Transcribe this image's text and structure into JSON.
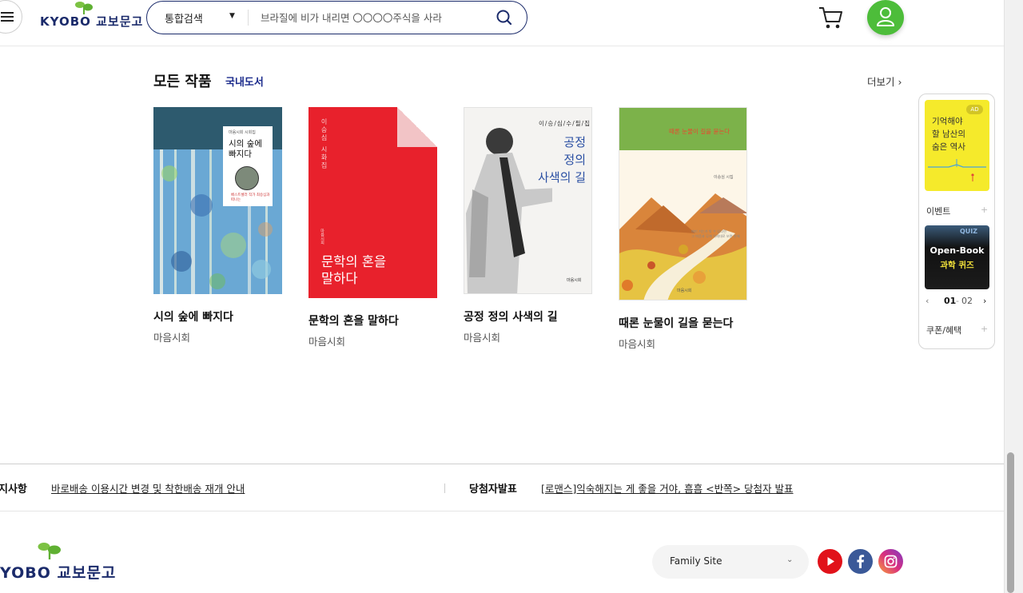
{
  "header": {
    "logo_text": "KYOBO 교보문고",
    "search": {
      "category": "통합검색",
      "placeholder": "브라질에 비가 내리면 〇〇〇〇주식을 사라"
    }
  },
  "section": {
    "title": "모든 작품",
    "subtitle": "국내도서",
    "more_label": "더보기",
    "more_arrow": "›"
  },
  "books": [
    {
      "title": "시의 숲에 빠지다",
      "publisher": "마음시회",
      "cover": {
        "series": "마음시회 시회집",
        "title_line1": "시의 숲에",
        "title_line2": "빠지다",
        "tagline": "베스트셀러 작가 최승심과 떠나는",
        "color": "#2d5a6e"
      }
    },
    {
      "title": "문학의 혼을 말하다",
      "publisher": "마음시회",
      "cover": {
        "vertical": "이승심 시화집",
        "vertical_small": "마음시회",
        "title_line1": "문학의 혼을",
        "title_line2": "말하다",
        "color": "#e8212c"
      }
    },
    {
      "title": "공정 정의 사색의 길",
      "publisher": "마음시회",
      "cover": {
        "series": "이/승/심/수/필/집",
        "title_line1": "공정",
        "title_line2": "정의",
        "title_line3": "사색의 길",
        "pub": "마음시회",
        "color": "#2a4fa3"
      }
    },
    {
      "title": "때론 눈물이 길을 묻는다",
      "publisher": "마음시회",
      "cover": {
        "top": "때론 눈물이 길을 묻는다",
        "author": "이승심 시집",
        "desc_line1": "매미 거는가 밖 수 있다면",
        "desc_line2": "그 마음과 무게 차례대로 보면 완해",
        "pub": "마음시회",
        "color": "#7cb24a"
      }
    }
  ],
  "side_panel": {
    "ad": {
      "badge": "AD",
      "line1": "기억해야",
      "line2": "할 남산의",
      "line3": "숨은 역사"
    },
    "event_label": "이벤트",
    "plus": "+",
    "quiz": {
      "tag": "QUIZ",
      "line1": "Open-Book",
      "line2": "과학 퀴즈"
    },
    "pager": {
      "prev": "‹",
      "current": "01",
      "separator": "-",
      "total": "02",
      "next": "›"
    },
    "coupon_label": "쿠폰/혜택"
  },
  "notice": {
    "label1": "지사항",
    "link1": "바로배송 이용시간 변경 및 착한배송 재개 안내",
    "separator": "|",
    "label2": "당첨자발표",
    "link2": "[로맨스]익숙해지는 게 좋을 거야, 흠흠 <반쪽> 당첨자 발표"
  },
  "footer": {
    "logo_text": "YOBO 교보문고",
    "family_site": "Family Site",
    "family_caret": "⌄"
  },
  "colors": {
    "brand_navy": "#1b2b6b",
    "brand_green": "#4dbd3a",
    "youtube": "#e1121a",
    "facebook": "#3b5998",
    "instagram": "#c13584"
  }
}
